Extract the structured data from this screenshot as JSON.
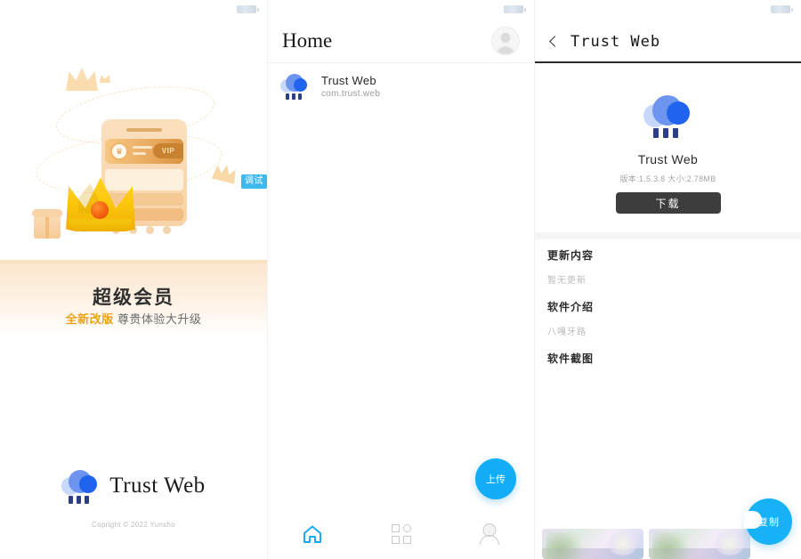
{
  "splash": {
    "debug_badge": "调试",
    "vip_card_label": "VIP",
    "title": "超级会员",
    "sub_highlight": "全新改版",
    "sub_rest": "尊贵体验大升级",
    "brand_name": "Trust Web",
    "copyright": "Copright © 2022 Yunsho"
  },
  "home": {
    "title": "Home",
    "avatar_icon": "user-avatar-icon",
    "apps": [
      {
        "name": "Trust Web",
        "package": "com.trust.web",
        "icon": "cloud-rain-icon"
      }
    ],
    "fab_label": "上传",
    "tabs": [
      {
        "id": "home",
        "icon": "home-icon",
        "active": true
      },
      {
        "id": "apps",
        "icon": "grid-icon",
        "active": false
      },
      {
        "id": "profile",
        "icon": "user-icon",
        "active": false
      }
    ]
  },
  "detail": {
    "back_icon": "chevron-left-icon",
    "title": "Trust Web",
    "app_icon": "cloud-rain-icon",
    "app_name": "Trust Web",
    "meta": "版本:1.5.3.8 大小:2.78MB",
    "download_label": "下载",
    "sections": [
      {
        "heading": "更新内容",
        "body": "暂无更新"
      },
      {
        "heading": "软件介绍",
        "body": "八嘎牙路"
      },
      {
        "heading": "软件截图",
        "body": ""
      }
    ],
    "screenshots": [
      "screenshot-1",
      "screenshot-2"
    ],
    "copy_fab_label": "复制"
  },
  "statusbar": {
    "battery_icon": "battery-icon"
  },
  "colors": {
    "accent_blue": "#13adf7",
    "logo_blue": "#1f63ef",
    "logo_mid": "#6d95f0",
    "logo_light": "#c7d8fb",
    "gold": "#e8a21c",
    "debug_badge_bg": "#3fb8ef",
    "download_btn_bg": "#3d3d3d"
  }
}
